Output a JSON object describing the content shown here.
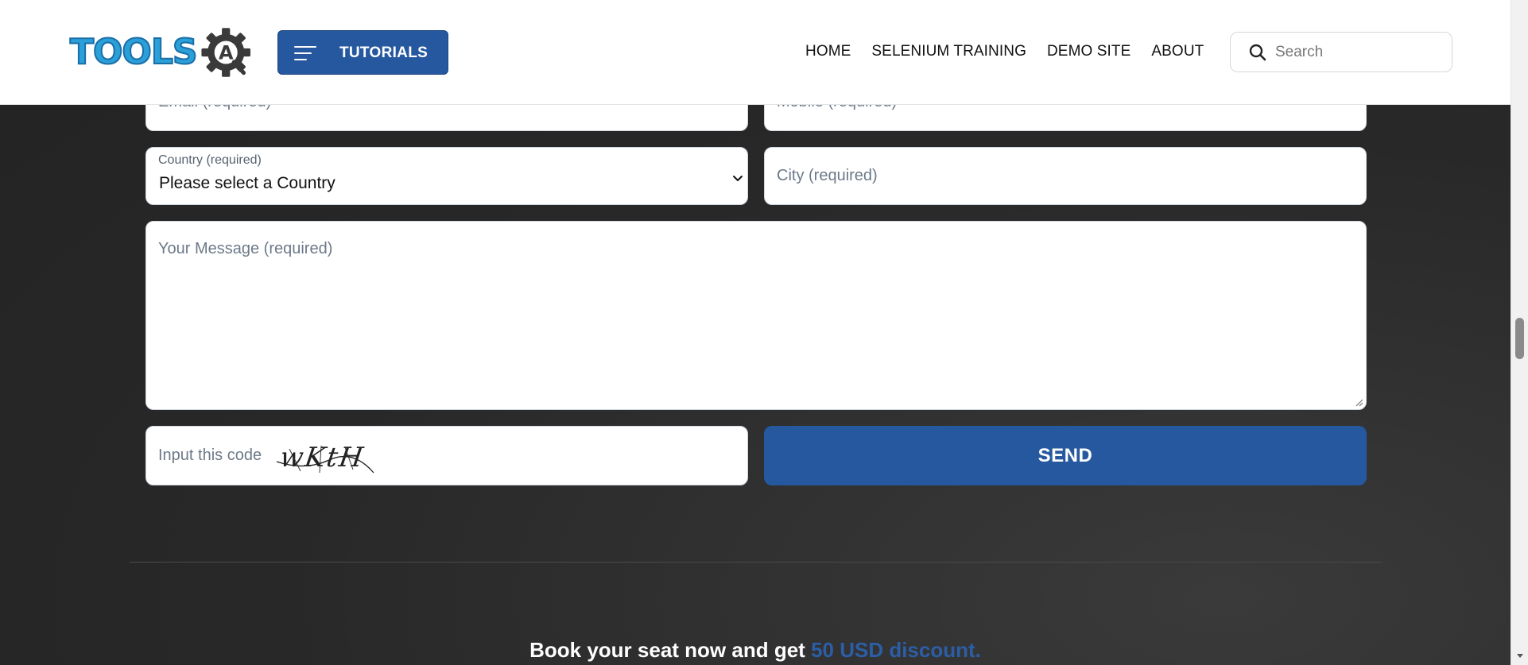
{
  "header": {
    "logo_text": "TOOLS",
    "logo_badge": "A",
    "tutorials_label": "TUTORIALS",
    "nav": [
      "HOME",
      "SELENIUM TRAINING",
      "DEMO SITE",
      "ABOUT"
    ],
    "search_placeholder": "Search"
  },
  "form": {
    "email_placeholder": "Email (required)",
    "mobile_placeholder": "Mobile (required)",
    "country_label": "Country (required)",
    "country_value": "Please select a Country",
    "city_placeholder": "City (required)",
    "message_placeholder": "Your Message (required)",
    "captcha_label": "Input this code",
    "captcha_code": "wKtH",
    "send_label": "SEND"
  },
  "promo": {
    "text": "Book your seat now and get",
    "highlight": "50 USD discount."
  },
  "colors": {
    "brand_blue": "#2658a0",
    "logo_blue": "#2a9fd8",
    "background_dark": "#282828"
  }
}
